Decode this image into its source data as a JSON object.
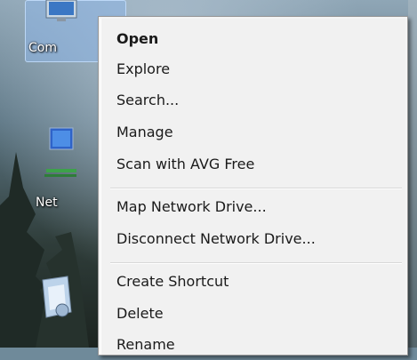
{
  "desktop": {
    "icons": [
      {
        "label": "Com",
        "icon": "computer-icon"
      },
      {
        "label": "Net",
        "icon": "network-icon"
      },
      {
        "label": "",
        "icon": "recycle-bin-icon"
      }
    ]
  },
  "context_menu": {
    "groups": [
      [
        {
          "label": "Open",
          "bold": true
        },
        {
          "label": "Explore"
        },
        {
          "label": "Search..."
        },
        {
          "label": "Manage"
        },
        {
          "label": "Scan with AVG Free"
        }
      ],
      [
        {
          "label": "Map Network Drive..."
        },
        {
          "label": "Disconnect Network Drive..."
        }
      ],
      [
        {
          "label": "Create Shortcut"
        },
        {
          "label": "Delete"
        },
        {
          "label": "Rename"
        }
      ]
    ]
  },
  "colors": {
    "menu_background": "#f1f1f1",
    "menu_border": "#979797",
    "selection_highlight": "#8cb4e6"
  }
}
